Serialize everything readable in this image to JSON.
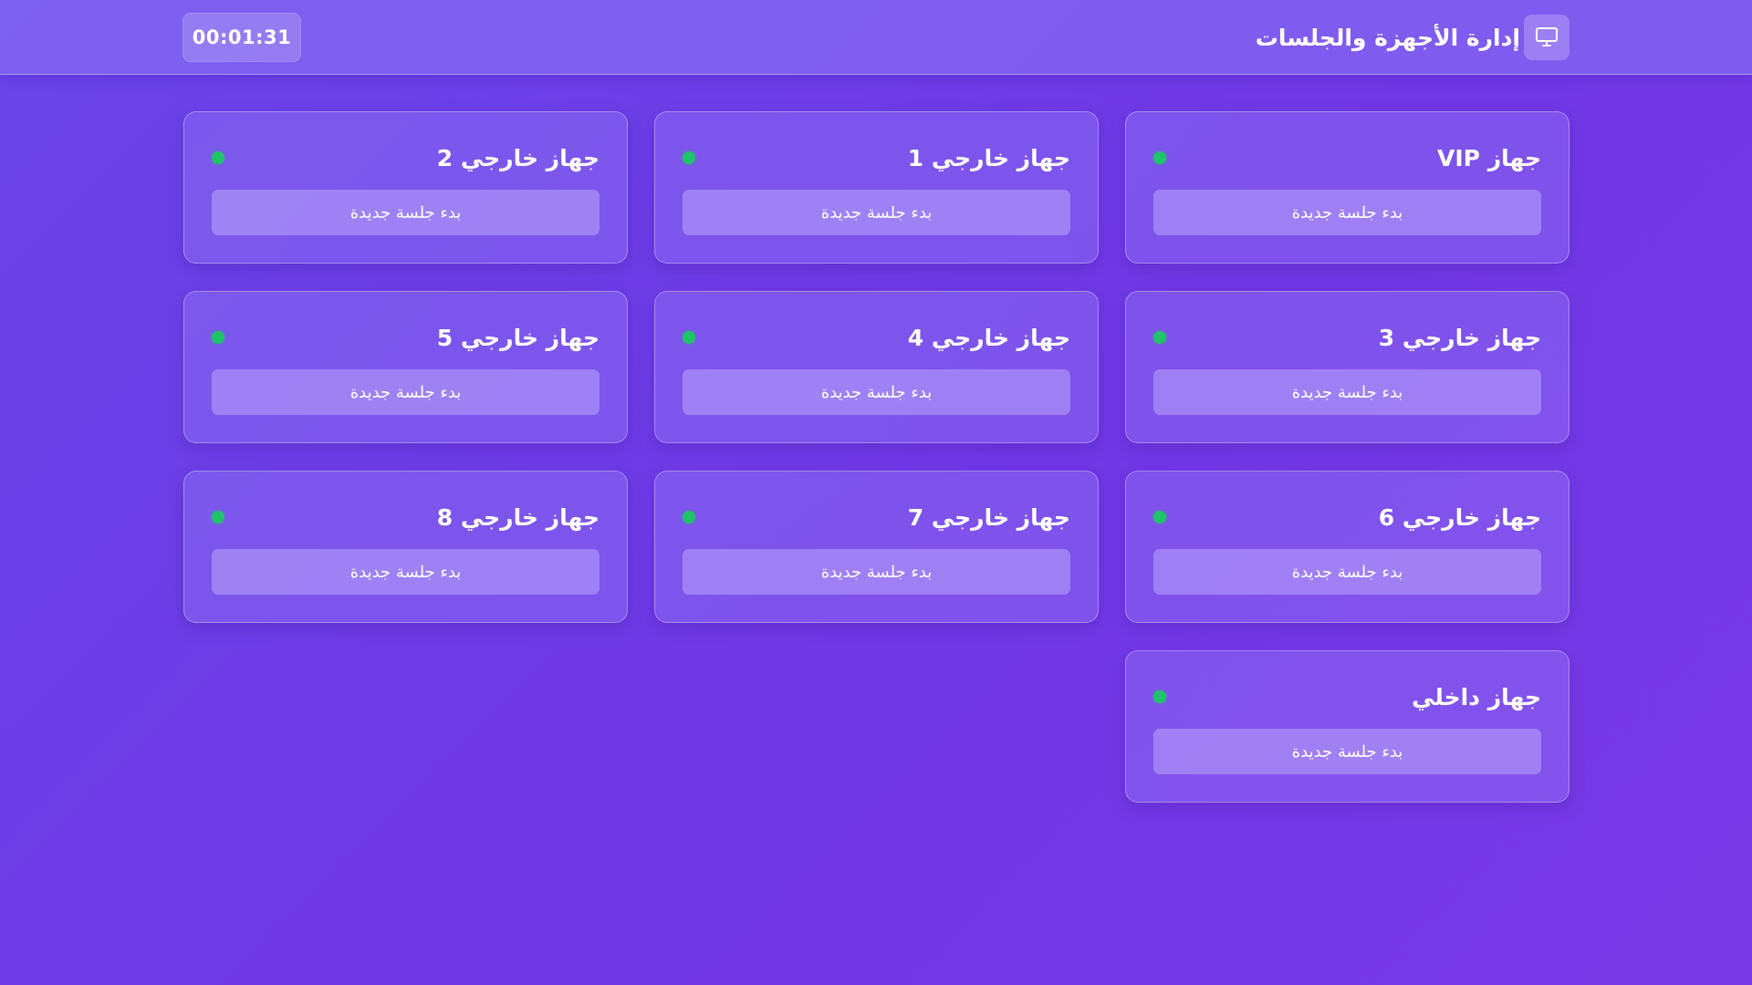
{
  "header": {
    "title": "إدارة الأجهزة والجلسات",
    "icon": "monitor-icon",
    "timer": "00:01:31"
  },
  "colors": {
    "status_online": "#1fc46a"
  },
  "devices": [
    {
      "name": "جهاز VIP",
      "status": "online",
      "button_label": "بدء جلسة جديدة"
    },
    {
      "name": "جهاز خارجي 1",
      "status": "online",
      "button_label": "بدء جلسة جديدة"
    },
    {
      "name": "جهاز خارجي 2",
      "status": "online",
      "button_label": "بدء جلسة جديدة"
    },
    {
      "name": "جهاز خارجي 3",
      "status": "online",
      "button_label": "بدء جلسة جديدة"
    },
    {
      "name": "جهاز خارجي 4",
      "status": "online",
      "button_label": "بدء جلسة جديدة"
    },
    {
      "name": "جهاز خارجي 5",
      "status": "online",
      "button_label": "بدء جلسة جديدة"
    },
    {
      "name": "جهاز خارجي 6",
      "status": "online",
      "button_label": "بدء جلسة جديدة"
    },
    {
      "name": "جهاز خارجي 7",
      "status": "online",
      "button_label": "بدء جلسة جديدة"
    },
    {
      "name": "جهاز خارجي 8",
      "status": "online",
      "button_label": "بدء جلسة جديدة"
    },
    {
      "name": "جهاز داخلي",
      "status": "online",
      "button_label": "بدء جلسة جديدة"
    }
  ]
}
